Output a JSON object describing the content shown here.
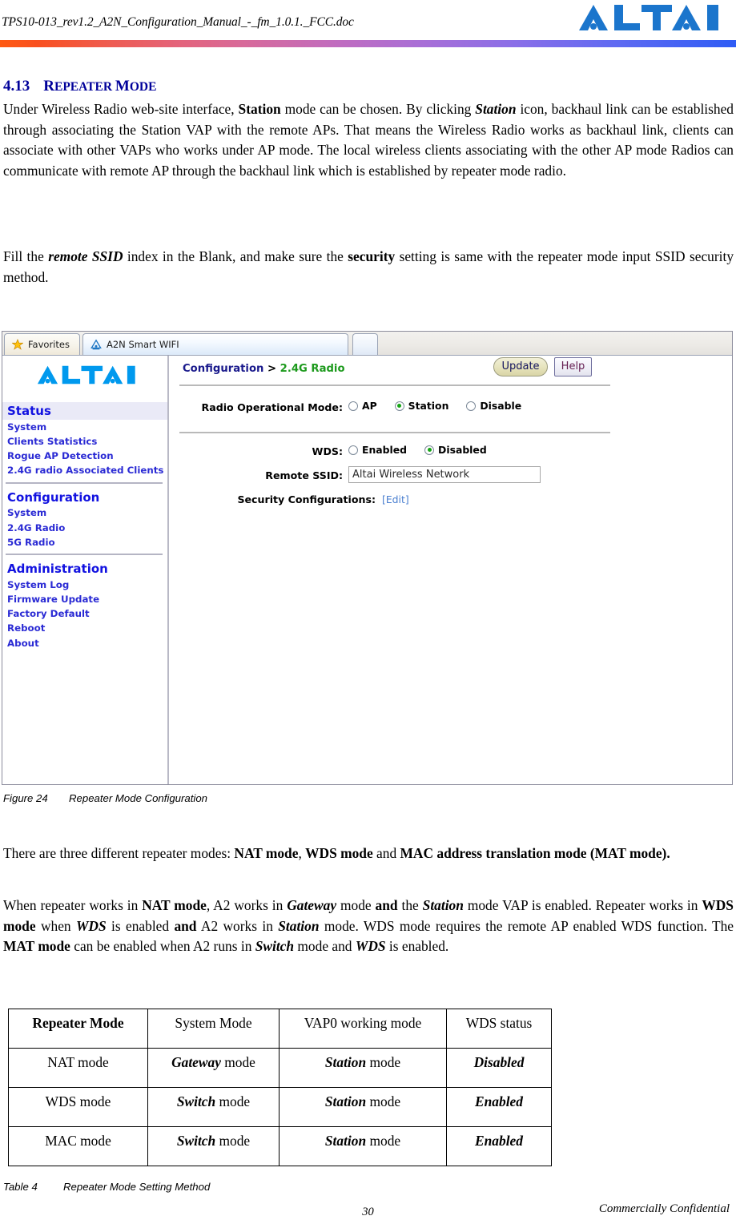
{
  "header": {
    "filename": "TPS10-013_rev1.2_A2N_Configuration_Manual_-_fm_1.0.1._FCC.doc",
    "logo_text": "ALTAI",
    "logo_color": "#1B75CC",
    "rule_gradient_from": "#FF5A12",
    "rule_gradient_to": "#2E5CF5"
  },
  "section": {
    "number": "4.13",
    "title": "REPEATER MODE",
    "title_first_caps": "R",
    "title_rest_1": "EPEATER ",
    "title_first_caps_2": "M",
    "title_rest_2": "ODE",
    "color": "#00009A"
  },
  "paragraphs": {
    "p1_a": "Under Wireless Radio web-site interface, ",
    "p1_b_station": "Station",
    "p1_c": " mode can be chosen. By clicking ",
    "p1_d_station_i": "Station",
    "p1_e": " icon, backhaul link can be established through associating the Station VAP with the remote APs. That means the Wireless Radio works as backhaul link, clients can associate with other VAPs who works under AP mode. The local wireless clients associating with the other AP mode Radios can communicate with remote AP through the backhaul link which is established by repeater mode radio.",
    "p2_a": "Fill the ",
    "p2_b_remote_ssid": "remote SSID",
    "p2_c": " index in the Blank, and make sure the ",
    "p2_d_security": "security",
    "p2_e": " setting is same with the repeater mode input SSID security method.",
    "p3_a": "There are three different repeater modes: ",
    "p3_b_nat": "NAT mode",
    "p3_c": ", ",
    "p3_d_wds": "WDS mode",
    "p3_e": " and ",
    "p3_f_mac": "MAC address translation mode (MAT mode).",
    "p4_a": "When repeater works in ",
    "p4_b_nat": "NAT mode",
    "p4_c": ", A2 works in ",
    "p4_d_gateway": "Gateway",
    "p4_e": " mode ",
    "p4_f_and": "and",
    "p4_g": " the ",
    "p4_h_station": "Station",
    "p4_i": " mode VAP is enabled. Repeater works in ",
    "p4_j_wds": "WDS mode",
    "p4_k": " when ",
    "p4_l_wds_i": "WDS",
    "p4_m": " is enabled ",
    "p4_n_and": "and",
    "p4_o": " A2 works in ",
    "p4_p_station": "Station",
    "p4_q": " mode. WDS mode requires the remote AP enabled WDS function. The ",
    "p4_r_mat": "MAT mode",
    "p4_s": " can be enabled when A2 runs in ",
    "p4_t_switch": "Switch",
    "p4_u": " mode and ",
    "p4_v_wds": "WDS",
    "p4_w": " is enabled."
  },
  "figure": {
    "caption_label": "Figure 24",
    "caption_text": "Repeater Mode Configuration",
    "browser": {
      "tabs": [
        {
          "label": "Favorites",
          "icon": "star-icon",
          "active": false
        },
        {
          "label": "A2N Smart WIFI",
          "icon": "altai-site-icon",
          "active": true
        },
        {
          "label": "",
          "icon": "new-tab-icon",
          "active": false
        }
      ]
    },
    "webui": {
      "logo_text": "ALTAI",
      "logo_color": "#0099EE",
      "nav": [
        {
          "heading": "Status",
          "items": [
            "System",
            "Clients Statistics",
            "Rogue AP Detection",
            "2.4G radio Associated Clients"
          ]
        },
        {
          "heading": "Configuration",
          "items": [
            "System",
            "2.4G Radio",
            "5G Radio"
          ]
        },
        {
          "heading": "Administration",
          "items": [
            "System Log",
            "Firmware Update",
            "Factory Default",
            "Reboot",
            "About"
          ]
        }
      ],
      "breadcrumb": {
        "first": "Configuration",
        "separator": ">",
        "second": "2.4G Radio",
        "first_color": "#1A1A8C",
        "second_color": "#1D9A1D"
      },
      "buttons": {
        "update": "Update",
        "help": "Help"
      },
      "fields": {
        "radio_mode_label": "Radio Operational Mode:",
        "radio_mode_options": [
          {
            "label": "AP",
            "selected": false
          },
          {
            "label": "Station",
            "selected": true
          },
          {
            "label": "Disable",
            "selected": false
          }
        ],
        "wds_label": "WDS:",
        "wds_options": [
          {
            "label": "Enabled",
            "selected": false
          },
          {
            "label": "Disabled",
            "selected": true
          }
        ],
        "ssid_label": "Remote  SSID:",
        "ssid_value": "Altai Wireless Network",
        "security_label": "Security Configurations:",
        "security_link": "[Edit]"
      }
    }
  },
  "table": {
    "caption_label": "Table 4",
    "caption_text": "Repeater Mode Setting Method",
    "headers": [
      "Repeater Mode",
      "System Mode",
      "VAP0 working mode",
      "WDS status"
    ],
    "rows": [
      {
        "mode": "NAT mode",
        "system_em": "Gateway",
        "system_rest": " mode",
        "vap0_em": "Station",
        "vap0_rest": " mode",
        "wds": "Disabled"
      },
      {
        "mode": "WDS mode",
        "system_em": "Switch",
        "system_rest": " mode",
        "vap0_em": "Station",
        "vap0_rest": " mode",
        "wds": "Enabled"
      },
      {
        "mode": "MAC mode",
        "system_em": "Switch",
        "system_rest": " mode",
        "vap0_em": "Station",
        "vap0_rest": " mode",
        "wds": "Enabled"
      }
    ]
  },
  "footer": {
    "page_number": "30",
    "confidential": "Commercially Confidential"
  }
}
